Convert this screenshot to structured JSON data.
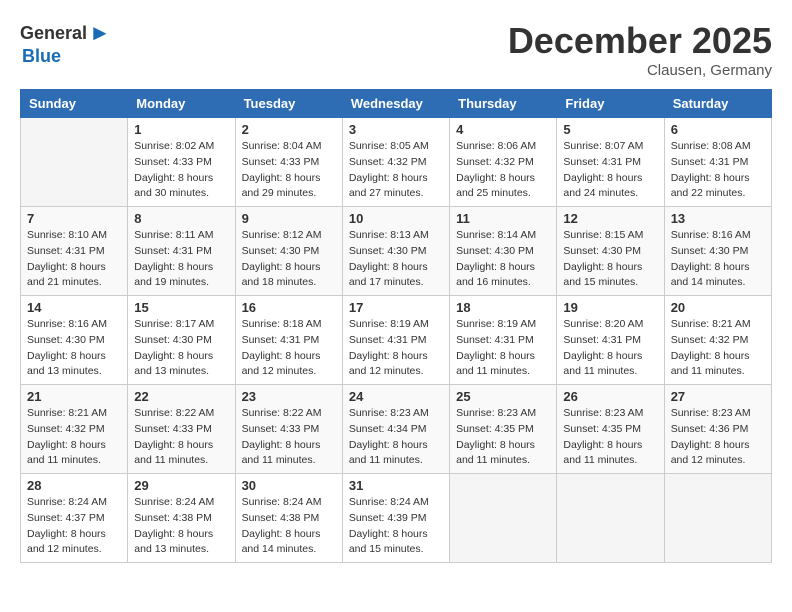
{
  "logo": {
    "general": "General",
    "blue": "Blue"
  },
  "title": "December 2025",
  "location": "Clausen, Germany",
  "weekdays": [
    "Sunday",
    "Monday",
    "Tuesday",
    "Wednesday",
    "Thursday",
    "Friday",
    "Saturday"
  ],
  "weeks": [
    [
      {
        "day": "",
        "sunrise": "",
        "sunset": "",
        "daylight": ""
      },
      {
        "day": "1",
        "sunrise": "Sunrise: 8:02 AM",
        "sunset": "Sunset: 4:33 PM",
        "daylight": "Daylight: 8 hours and 30 minutes."
      },
      {
        "day": "2",
        "sunrise": "Sunrise: 8:04 AM",
        "sunset": "Sunset: 4:33 PM",
        "daylight": "Daylight: 8 hours and 29 minutes."
      },
      {
        "day": "3",
        "sunrise": "Sunrise: 8:05 AM",
        "sunset": "Sunset: 4:32 PM",
        "daylight": "Daylight: 8 hours and 27 minutes."
      },
      {
        "day": "4",
        "sunrise": "Sunrise: 8:06 AM",
        "sunset": "Sunset: 4:32 PM",
        "daylight": "Daylight: 8 hours and 25 minutes."
      },
      {
        "day": "5",
        "sunrise": "Sunrise: 8:07 AM",
        "sunset": "Sunset: 4:31 PM",
        "daylight": "Daylight: 8 hours and 24 minutes."
      },
      {
        "day": "6",
        "sunrise": "Sunrise: 8:08 AM",
        "sunset": "Sunset: 4:31 PM",
        "daylight": "Daylight: 8 hours and 22 minutes."
      }
    ],
    [
      {
        "day": "7",
        "sunrise": "Sunrise: 8:10 AM",
        "sunset": "Sunset: 4:31 PM",
        "daylight": "Daylight: 8 hours and 21 minutes."
      },
      {
        "day": "8",
        "sunrise": "Sunrise: 8:11 AM",
        "sunset": "Sunset: 4:31 PM",
        "daylight": "Daylight: 8 hours and 19 minutes."
      },
      {
        "day": "9",
        "sunrise": "Sunrise: 8:12 AM",
        "sunset": "Sunset: 4:30 PM",
        "daylight": "Daylight: 8 hours and 18 minutes."
      },
      {
        "day": "10",
        "sunrise": "Sunrise: 8:13 AM",
        "sunset": "Sunset: 4:30 PM",
        "daylight": "Daylight: 8 hours and 17 minutes."
      },
      {
        "day": "11",
        "sunrise": "Sunrise: 8:14 AM",
        "sunset": "Sunset: 4:30 PM",
        "daylight": "Daylight: 8 hours and 16 minutes."
      },
      {
        "day": "12",
        "sunrise": "Sunrise: 8:15 AM",
        "sunset": "Sunset: 4:30 PM",
        "daylight": "Daylight: 8 hours and 15 minutes."
      },
      {
        "day": "13",
        "sunrise": "Sunrise: 8:16 AM",
        "sunset": "Sunset: 4:30 PM",
        "daylight": "Daylight: 8 hours and 14 minutes."
      }
    ],
    [
      {
        "day": "14",
        "sunrise": "Sunrise: 8:16 AM",
        "sunset": "Sunset: 4:30 PM",
        "daylight": "Daylight: 8 hours and 13 minutes."
      },
      {
        "day": "15",
        "sunrise": "Sunrise: 8:17 AM",
        "sunset": "Sunset: 4:30 PM",
        "daylight": "Daylight: 8 hours and 13 minutes."
      },
      {
        "day": "16",
        "sunrise": "Sunrise: 8:18 AM",
        "sunset": "Sunset: 4:31 PM",
        "daylight": "Daylight: 8 hours and 12 minutes."
      },
      {
        "day": "17",
        "sunrise": "Sunrise: 8:19 AM",
        "sunset": "Sunset: 4:31 PM",
        "daylight": "Daylight: 8 hours and 12 minutes."
      },
      {
        "day": "18",
        "sunrise": "Sunrise: 8:19 AM",
        "sunset": "Sunset: 4:31 PM",
        "daylight": "Daylight: 8 hours and 11 minutes."
      },
      {
        "day": "19",
        "sunrise": "Sunrise: 8:20 AM",
        "sunset": "Sunset: 4:31 PM",
        "daylight": "Daylight: 8 hours and 11 minutes."
      },
      {
        "day": "20",
        "sunrise": "Sunrise: 8:21 AM",
        "sunset": "Sunset: 4:32 PM",
        "daylight": "Daylight: 8 hours and 11 minutes."
      }
    ],
    [
      {
        "day": "21",
        "sunrise": "Sunrise: 8:21 AM",
        "sunset": "Sunset: 4:32 PM",
        "daylight": "Daylight: 8 hours and 11 minutes."
      },
      {
        "day": "22",
        "sunrise": "Sunrise: 8:22 AM",
        "sunset": "Sunset: 4:33 PM",
        "daylight": "Daylight: 8 hours and 11 minutes."
      },
      {
        "day": "23",
        "sunrise": "Sunrise: 8:22 AM",
        "sunset": "Sunset: 4:33 PM",
        "daylight": "Daylight: 8 hours and 11 minutes."
      },
      {
        "day": "24",
        "sunrise": "Sunrise: 8:23 AM",
        "sunset": "Sunset: 4:34 PM",
        "daylight": "Daylight: 8 hours and 11 minutes."
      },
      {
        "day": "25",
        "sunrise": "Sunrise: 8:23 AM",
        "sunset": "Sunset: 4:35 PM",
        "daylight": "Daylight: 8 hours and 11 minutes."
      },
      {
        "day": "26",
        "sunrise": "Sunrise: 8:23 AM",
        "sunset": "Sunset: 4:35 PM",
        "daylight": "Daylight: 8 hours and 11 minutes."
      },
      {
        "day": "27",
        "sunrise": "Sunrise: 8:23 AM",
        "sunset": "Sunset: 4:36 PM",
        "daylight": "Daylight: 8 hours and 12 minutes."
      }
    ],
    [
      {
        "day": "28",
        "sunrise": "Sunrise: 8:24 AM",
        "sunset": "Sunset: 4:37 PM",
        "daylight": "Daylight: 8 hours and 12 minutes."
      },
      {
        "day": "29",
        "sunrise": "Sunrise: 8:24 AM",
        "sunset": "Sunset: 4:38 PM",
        "daylight": "Daylight: 8 hours and 13 minutes."
      },
      {
        "day": "30",
        "sunrise": "Sunrise: 8:24 AM",
        "sunset": "Sunset: 4:38 PM",
        "daylight": "Daylight: 8 hours and 14 minutes."
      },
      {
        "day": "31",
        "sunrise": "Sunrise: 8:24 AM",
        "sunset": "Sunset: 4:39 PM",
        "daylight": "Daylight: 8 hours and 15 minutes."
      },
      {
        "day": "",
        "sunrise": "",
        "sunset": "",
        "daylight": ""
      },
      {
        "day": "",
        "sunrise": "",
        "sunset": "",
        "daylight": ""
      },
      {
        "day": "",
        "sunrise": "",
        "sunset": "",
        "daylight": ""
      }
    ]
  ]
}
